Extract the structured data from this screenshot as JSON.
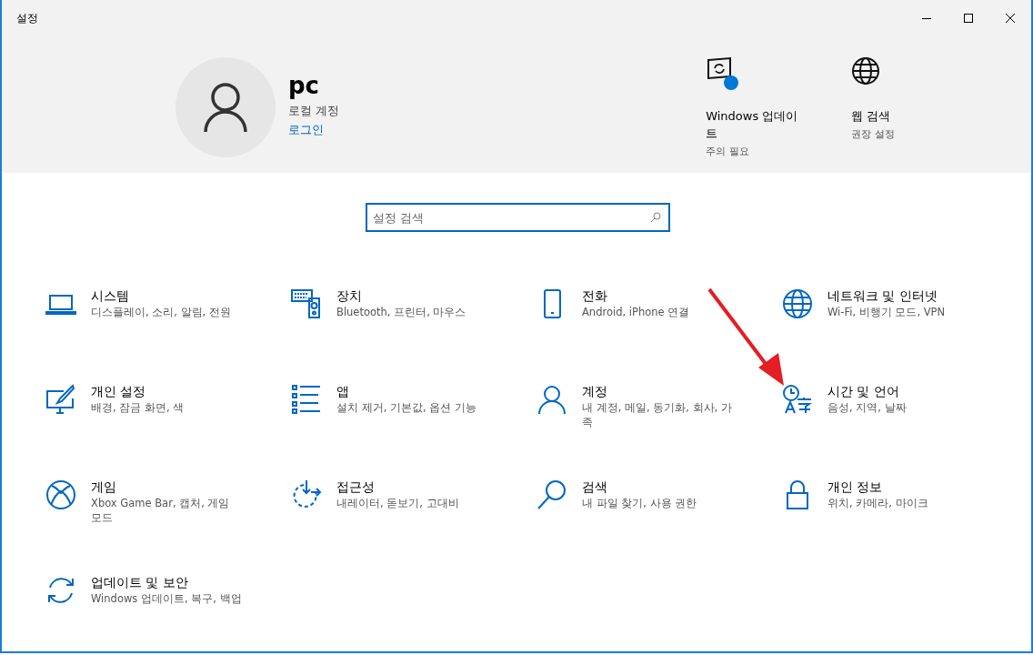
{
  "window": {
    "title": "설정"
  },
  "account": {
    "name": "pc",
    "type": "로컬 계정",
    "link": "로그인"
  },
  "shortcuts": [
    {
      "kind": "update",
      "title": "Windows 업데이트",
      "subtitle": "주의 필요"
    },
    {
      "kind": "globe",
      "title": "웹 검색",
      "subtitle": "권장 설정"
    }
  ],
  "search": {
    "placeholder": "설정 검색"
  },
  "tiles": [
    {
      "kind": "laptop",
      "title": "시스템",
      "desc": "디스플레이, 소리, 알림, 전원"
    },
    {
      "kind": "devices",
      "title": "장치",
      "desc": "Bluetooth, 프린터, 마우스"
    },
    {
      "kind": "phone",
      "title": "전화",
      "desc": "Android, iPhone 연결"
    },
    {
      "kind": "globe",
      "title": "네트워크 및 인터넷",
      "desc": "Wi-Fi, 비행기 모드, VPN"
    },
    {
      "kind": "brush",
      "title": "개인 설정",
      "desc": "배경, 잠금 화면, 색"
    },
    {
      "kind": "apps",
      "title": "앱",
      "desc": "설치 제거, 기본값, 옵션 기능"
    },
    {
      "kind": "person",
      "title": "계정",
      "desc": "내 계정, 메일, 동기화, 회사, 가족"
    },
    {
      "kind": "timelang",
      "title": "시간 및 언어",
      "desc": "음성, 지역, 날짜"
    },
    {
      "kind": "xbox",
      "title": "게임",
      "desc": "Xbox Game Bar, 캡처, 게임 모드"
    },
    {
      "kind": "access",
      "title": "접근성",
      "desc": "내레이터, 돋보기, 고대비"
    },
    {
      "kind": "search",
      "title": "검색",
      "desc": "내 파일 찾기, 사용 권한"
    },
    {
      "kind": "lock",
      "title": "개인 정보",
      "desc": "위치, 카메라, 마이크"
    },
    {
      "kind": "sync",
      "title": "업데이트 및 보안",
      "desc": "Windows 업데이트, 복구, 백업"
    }
  ]
}
